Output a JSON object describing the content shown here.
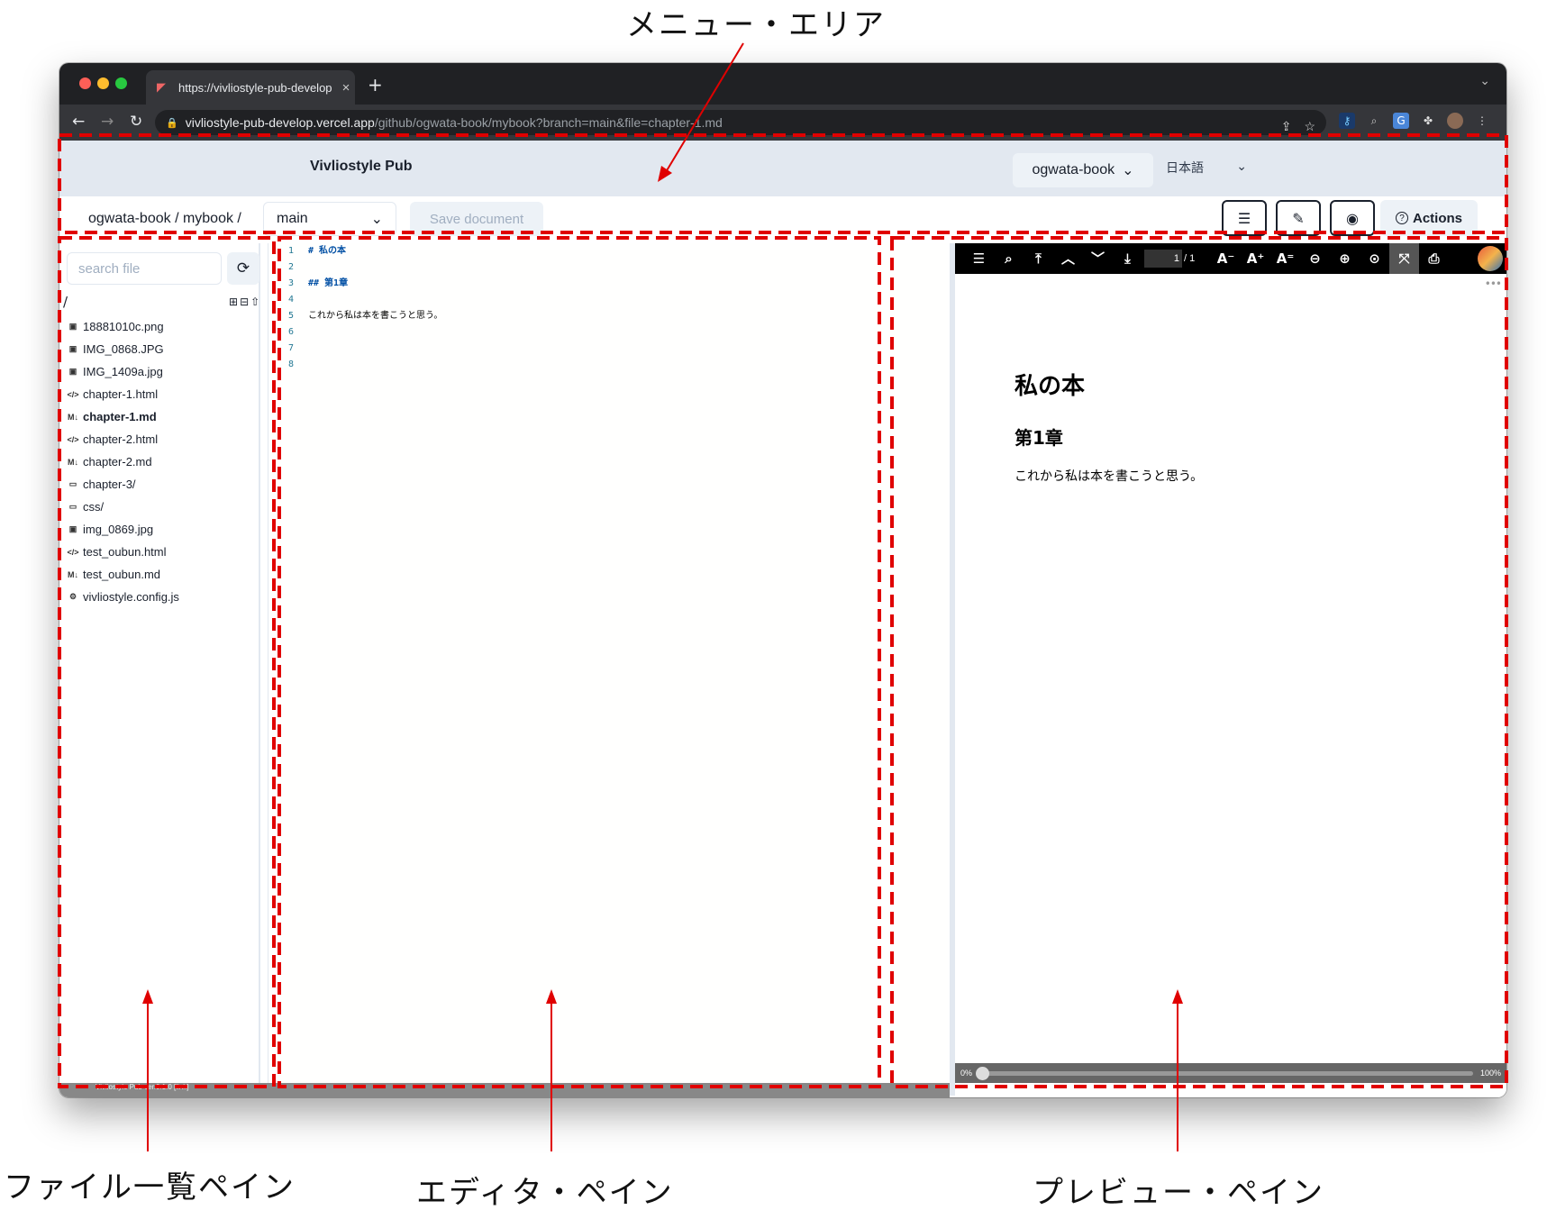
{
  "annotations": {
    "menu_area": "メニュー・エリア",
    "file_pane": "ファイル一覧ペイン",
    "editor_pane": "エディタ・ペイン",
    "preview_pane": "プレビュー・ペイン",
    "marker_color": "#e00000"
  },
  "browser": {
    "tab_title": "https://vivliostyle-pub-develop",
    "tab_close": "×",
    "new_tab": "+",
    "url_host": "vivliostyle-pub-develop.vercel.app",
    "url_path": "/github/ogwata-book/mybook?branch=main&file=chapter-1.md"
  },
  "header": {
    "app_title": "Vivliostyle Pub",
    "user": "ogwata-book",
    "language": "日本語"
  },
  "toolbar": {
    "breadcrumb": "ogwata-book / mybook /",
    "branch": "main",
    "save_label": "Save document",
    "actions_label": "Actions",
    "accent": "#edf2f7"
  },
  "filepane": {
    "search_placeholder": "search file",
    "root": "/",
    "files": [
      {
        "name": "18881010c.png",
        "icon": "image-file-icon",
        "glyph": "▣",
        "active": false
      },
      {
        "name": "IMG_0868.JPG",
        "icon": "image-file-icon",
        "glyph": "▣",
        "active": false
      },
      {
        "name": "IMG_1409a.jpg",
        "icon": "image-file-icon",
        "glyph": "▣",
        "active": false
      },
      {
        "name": "chapter-1.html",
        "icon": "code-file-icon",
        "glyph": "</>",
        "active": false
      },
      {
        "name": "chapter-1.md",
        "icon": "markdown-file-icon",
        "glyph": "M↓",
        "active": true
      },
      {
        "name": "chapter-2.html",
        "icon": "code-file-icon",
        "glyph": "</>",
        "active": false
      },
      {
        "name": "chapter-2.md",
        "icon": "markdown-file-icon",
        "glyph": "M↓",
        "active": false
      },
      {
        "name": "chapter-3/",
        "icon": "folder-icon",
        "glyph": "▭",
        "active": false
      },
      {
        "name": "css/",
        "icon": "folder-icon",
        "glyph": "▭",
        "active": false
      },
      {
        "name": "img_0869.jpg",
        "icon": "image-file-icon",
        "glyph": "▣",
        "active": false
      },
      {
        "name": "test_oubun.html",
        "icon": "code-file-icon",
        "glyph": "</>",
        "active": false
      },
      {
        "name": "test_oubun.md",
        "icon": "markdown-file-icon",
        "glyph": "M↓",
        "active": false
      },
      {
        "name": "vivliostyle.config.js",
        "icon": "gear-file-icon",
        "glyph": "⚙",
        "active": false
      }
    ]
  },
  "editor": {
    "lines": [
      {
        "no": "1",
        "text": "# 私の本",
        "heading": true
      },
      {
        "no": "2",
        "text": "",
        "heading": false
      },
      {
        "no": "3",
        "text": "## 第1章",
        "heading": true
      },
      {
        "no": "4",
        "text": "",
        "heading": false
      },
      {
        "no": "5",
        "text": "これから私は本を書こうと思う。",
        "heading": false
      },
      {
        "no": "6",
        "text": "",
        "heading": false
      },
      {
        "no": "7",
        "text": "",
        "heading": false
      },
      {
        "no": "8",
        "text": "",
        "heading": false
      }
    ]
  },
  "preview": {
    "page_current": "1",
    "page_total": "/ 1",
    "h1": "私の本",
    "h2": "第1章",
    "paragraph": "これから私は本を書こうと思う。",
    "progress_start": "0%",
    "progress_end": "100%",
    "progress_value": 0
  },
  "footer": {
    "version": "Vivliostyle Pub ver.0.1.0 [link]"
  }
}
